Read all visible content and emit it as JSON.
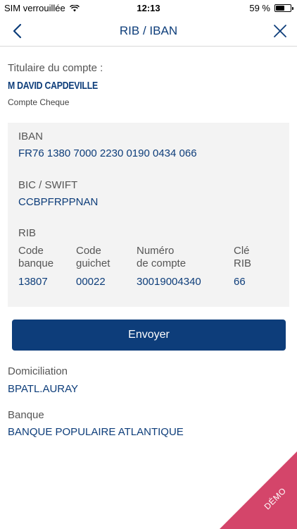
{
  "status_bar": {
    "carrier": "SIM verrouillée",
    "time": "12:13",
    "battery_text": "59 %",
    "battery_level": 0.59
  },
  "nav": {
    "title": "RIB / IBAN",
    "back_icon": "chevron-left-icon",
    "close_icon": "close-icon"
  },
  "holder": {
    "label": "Titulaire du compte :",
    "name": "M DAVID CAPDEVILLE",
    "account_type": "Compte Cheque"
  },
  "iban": {
    "label": "IBAN",
    "value": "FR76 1380 7000 2230 0190 0434 066"
  },
  "bic": {
    "label": "BIC / SWIFT",
    "value": "CCBPFRPPNAN"
  },
  "rib": {
    "label": "RIB",
    "columns": [
      {
        "head1": "Code",
        "head2": "banque",
        "value": "13807"
      },
      {
        "head1": "Code",
        "head2": "guichet",
        "value": "00022"
      },
      {
        "head1": "Numéro",
        "head2": "de compte",
        "value": "30019004340"
      },
      {
        "head1": "Clé",
        "head2": "RIB",
        "value": "66"
      }
    ]
  },
  "send_button": "Envoyer",
  "domiciliation": {
    "label": "Domiciliation",
    "value": "BPATL.AURAY"
  },
  "banque": {
    "label": "Banque",
    "value": "BANQUE POPULAIRE ATLANTIQUE"
  },
  "demo_label": "DÉMO",
  "colors": {
    "brand_blue": "#0d3d7a",
    "demo_pink": "#d4456a",
    "card_bg": "#f3f3f3"
  }
}
